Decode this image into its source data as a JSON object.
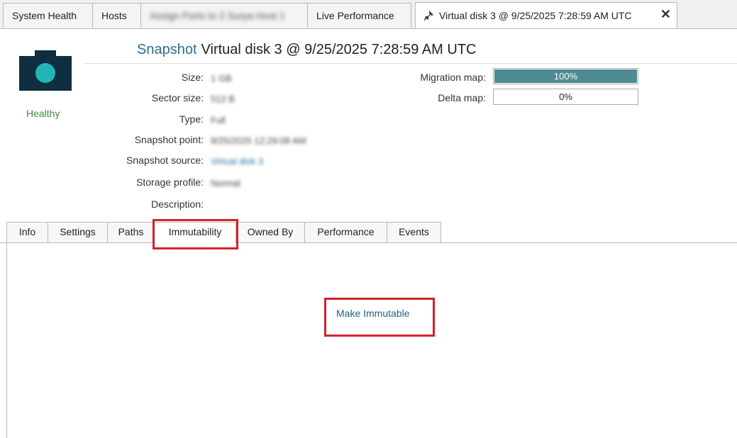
{
  "doc_tabs": [
    {
      "label": "System Health"
    },
    {
      "label": "Hosts"
    },
    {
      "label": "Assign Ports to 2 Surya Host 1"
    },
    {
      "label": "Live Performance"
    },
    {
      "label": "Virtual disk 3 @ 9/25/2025 7:28:59 AM UTC"
    }
  ],
  "header": {
    "status": "Healthy",
    "title_type": "Snapshot",
    "title_name": "Virtual disk 3 @ 9/25/2025 7:28:59 AM UTC"
  },
  "properties": [
    {
      "label": "Size:",
      "value": "1 GB"
    },
    {
      "label": "Sector size:",
      "value": "512 B"
    },
    {
      "label": "Type:",
      "value": "Full"
    },
    {
      "label": "Snapshot point:",
      "value": "9/25/2025 12:29:08 AM"
    },
    {
      "label": "Snapshot source:",
      "value": "Virtual disk 3"
    },
    {
      "label": "Storage profile:",
      "value": "Normal"
    },
    {
      "label": "Description:",
      "value": ""
    }
  ],
  "maps": {
    "migration_label": "Migration map:",
    "migration_value": "100%",
    "migration_fraction": 1.0,
    "delta_label": "Delta map:",
    "delta_value": "0%",
    "delta_fraction": 0.0
  },
  "inner_tabs": [
    {
      "label": "Info"
    },
    {
      "label": "Settings"
    },
    {
      "label": "Paths"
    },
    {
      "label": "Immutability"
    },
    {
      "label": "Owned By"
    },
    {
      "label": "Performance"
    },
    {
      "label": "Events"
    }
  ],
  "immutability": {
    "action_label": "Make Immutable"
  },
  "colors": {
    "accent": "#2a6f8f",
    "healthy": "#3b8a3b",
    "progress": "#4d8a91",
    "highlight": "#d3222a"
  }
}
